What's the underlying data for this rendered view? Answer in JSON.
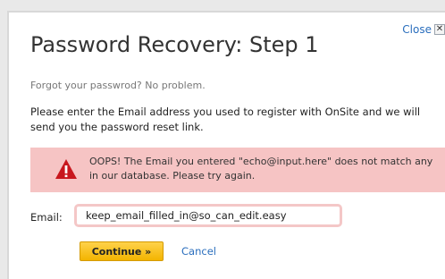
{
  "dialog": {
    "title": "Password Recovery: Step 1",
    "close_label": "Close",
    "close_x": "✕",
    "subtitle": "Forgot your passwrod? No problem.",
    "instructions": "Please enter the Email address you used to register with OnSite and we will send you the password reset link."
  },
  "error": {
    "icon": "warning-triangle-icon",
    "message": "OOPS! The Email you entered \"echo@input.here\" does not match any in our database. Please try again."
  },
  "form": {
    "email_label": "Email:",
    "email_value": "keep_email_filled_in@so_can_edit.easy",
    "continue_label": "Continue »",
    "cancel_label": "Cancel"
  },
  "colors": {
    "error_background": "#f6c4c4",
    "warning_icon": "#c8171e",
    "button": "#f3b400",
    "link": "#2a6ebd"
  }
}
